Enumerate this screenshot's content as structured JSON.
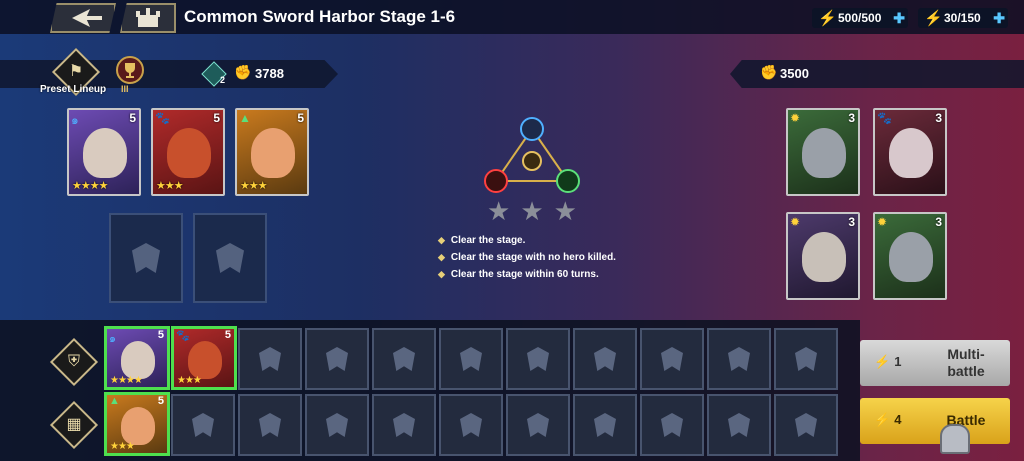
{
  "header": {
    "stage_title": "Common Sword Harbor Stage 1-6",
    "stamina": "500/500",
    "energy": "30/150"
  },
  "lineup": {
    "preset_label": "Preset Lineup",
    "rank_badge": "III",
    "faction_count": "2",
    "power": "3788"
  },
  "enemy": {
    "power": "3500"
  },
  "player_heroes": [
    {
      "level": "5",
      "stars": "★★★★",
      "class_icon": "swirl-icon",
      "color": "#6d4bb3"
    },
    {
      "level": "5",
      "stars": "★★★",
      "class_icon": "paw-icon",
      "color": "#b02a2a"
    },
    {
      "level": "5",
      "stars": "★★★",
      "class_icon": "peak-icon",
      "color": "#c97a1e"
    }
  ],
  "enemy_heroes": [
    {
      "level": "3",
      "class_icon": "sun-icon",
      "color": "#3b6b3a"
    },
    {
      "level": "3",
      "class_icon": "paw-icon",
      "color": "#6b2a3a"
    },
    {
      "level": "3",
      "class_icon": "sun-icon",
      "color": "#4d3a6b"
    },
    {
      "level": "3",
      "class_icon": "sun-icon",
      "color": "#3b6b3a"
    }
  ],
  "objectives": [
    "Clear the stage.",
    "Clear the stage with no hero killed.",
    "Clear the stage within 60 turns."
  ],
  "bench_heroes": [
    {
      "level": "5",
      "stars": "★★★★",
      "color": "#6d4bb3"
    },
    {
      "level": "5",
      "stars": "★★★",
      "color": "#b02a2a"
    },
    {
      "level": "5",
      "stars": "★★★",
      "color": "#c97a1e"
    }
  ],
  "buttons": {
    "multi_cost": "1",
    "multi_label": "Multi-battle",
    "battle_cost": "4",
    "battle_label": "Battle"
  },
  "colors": {
    "accent_gold": "#e9c13a",
    "select_green": "#4ee04e"
  }
}
